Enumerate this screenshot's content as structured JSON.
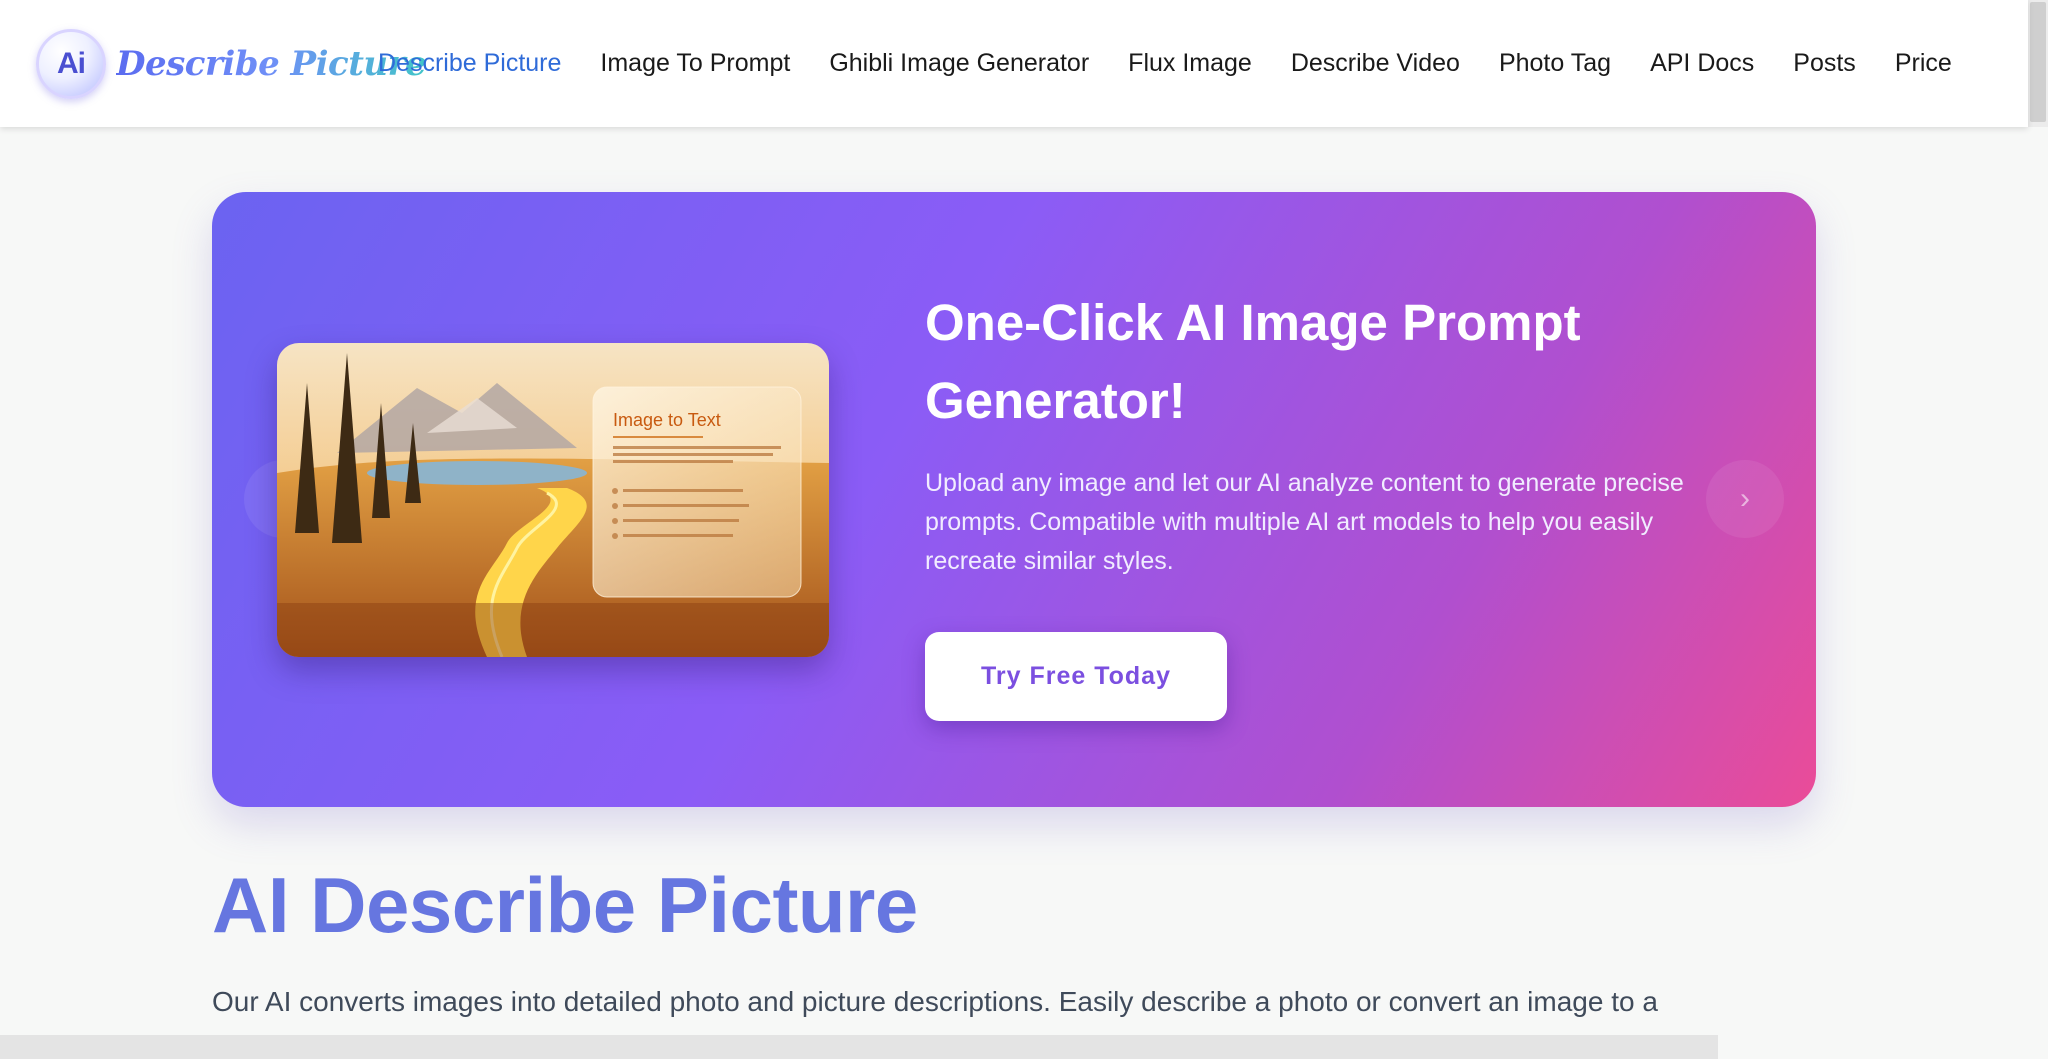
{
  "brand": {
    "badge": "Ai",
    "name": "Describe Picture"
  },
  "nav": {
    "items": [
      {
        "label": "Describe Picture",
        "active": true
      },
      {
        "label": "Image To Prompt"
      },
      {
        "label": "Ghibli Image Generator"
      },
      {
        "label": "Flux Image"
      },
      {
        "label": "Describe Video"
      },
      {
        "label": "Photo Tag"
      },
      {
        "label": "API Docs"
      },
      {
        "label": "Posts"
      },
      {
        "label": "Price"
      }
    ]
  },
  "hero": {
    "title": "One-Click AI Image Prompt Generator!",
    "description": "Upload any image and let our AI analyze content to generate precise prompts. Compatible with multiple AI art models to help you easily recreate similar styles.",
    "cta_label": "Try Free Today",
    "prev_arrow": "‹",
    "next_arrow": "›",
    "image_card": {
      "title": "Image to Text"
    }
  },
  "section": {
    "title": "AI Describe Picture",
    "description": "Our AI converts images into detailed photo and picture descriptions. Easily describe a photo or convert an image to a"
  },
  "colors": {
    "accent": "#2f6bd8",
    "hero_gradient": [
      "#6b63f1",
      "#8b5cf6",
      "#b04fcf",
      "#ea4c98"
    ],
    "section_title": "#6676e0",
    "cta_text": "#7b4fe0"
  }
}
